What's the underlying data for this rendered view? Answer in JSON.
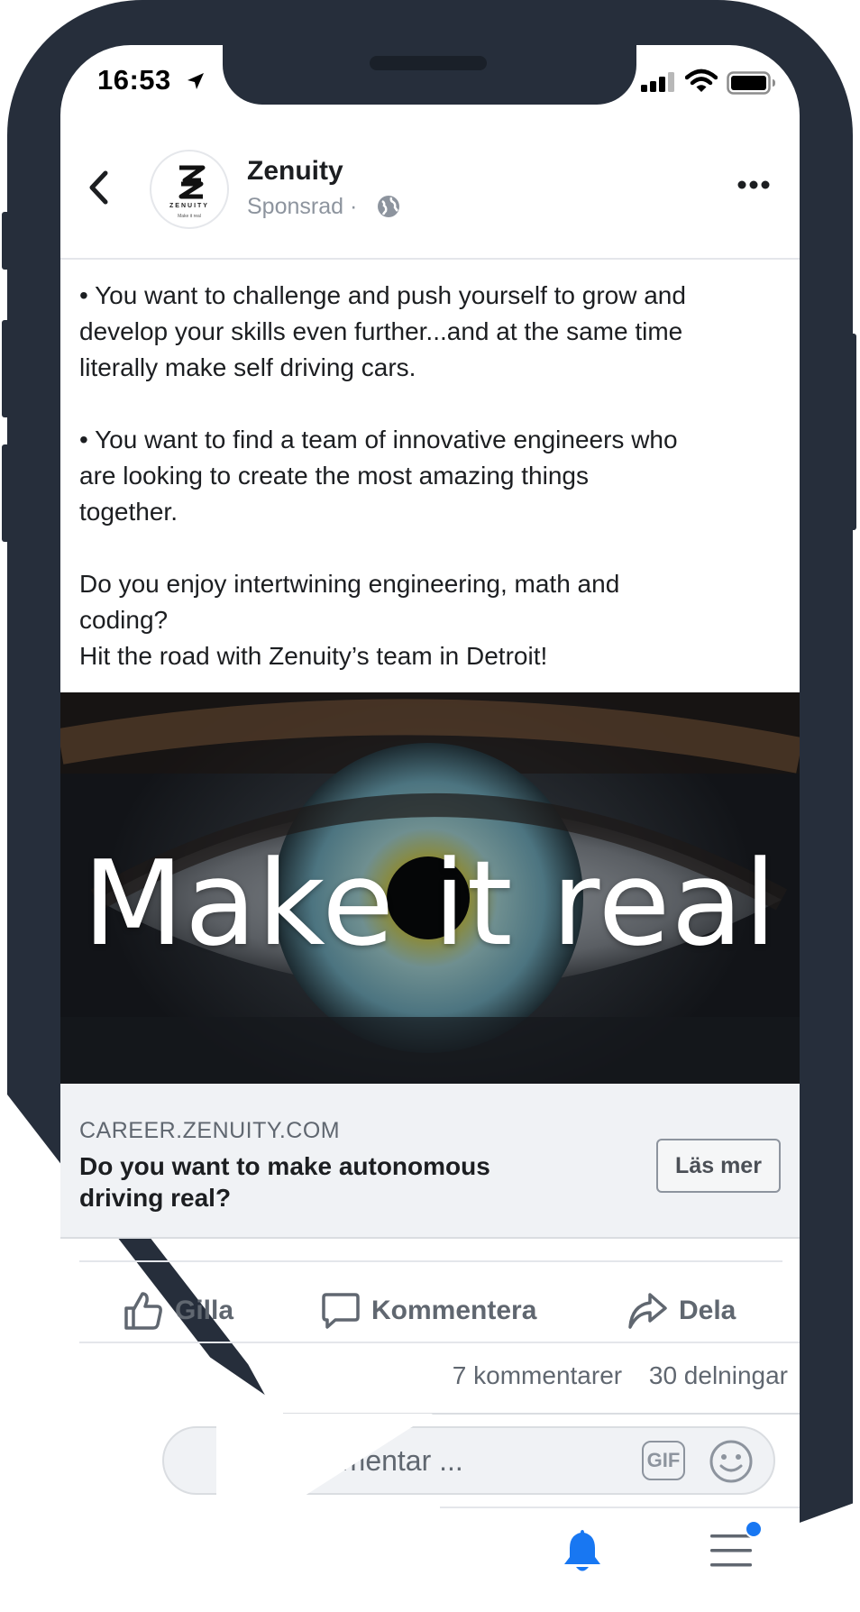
{
  "status_bar": {
    "time": "16:53"
  },
  "post": {
    "page_name": "Zenuity",
    "sponsored_label": "Sponsrad ·",
    "avatar": {
      "wordmark": "ZENUITY",
      "tagline": "Make it real"
    },
    "body_lines": [
      "• You want to challenge and push yourself to grow and",
      "develop your skills even further...and at the same time",
      "literally make self driving cars.",
      "",
      "• You want to find a team of innovative engineers who",
      "are looking to create the most amazing things",
      "together.",
      "",
      "Do you enjoy intertwining engineering, math and",
      "coding?",
      "Hit the road with Zenuity’s team in Detroit!"
    ],
    "image_headline": "Make it real"
  },
  "link_preview": {
    "domain": "CAREER.ZENUITY.COM",
    "title": "Do you want to make autonomous driving real?",
    "cta_label": "Läs mer"
  },
  "actions": {
    "like": "Gilla",
    "comment": "Kommentera",
    "share": "Dela"
  },
  "counts": {
    "comments": "7 kommentarer",
    "shares": "30 delningar"
  },
  "comment_box": {
    "placeholder": "mmentar ...",
    "gif_label": "GIF"
  },
  "colors": {
    "frame": "#262e3b",
    "text_primary": "#1c1e21",
    "text_secondary": "#606770",
    "accent": "#1877f2",
    "link_bg": "#f0f2f5"
  },
  "icons": [
    "location-arrow-icon",
    "signal-icon",
    "wifi-icon",
    "battery-icon",
    "back-chevron-icon",
    "globe-icon",
    "more-dots-icon",
    "like-thumb-icon",
    "comment-bubble-icon",
    "share-arrow-icon",
    "gif-icon",
    "emoji-icon",
    "bell-icon",
    "menu-icon"
  ]
}
